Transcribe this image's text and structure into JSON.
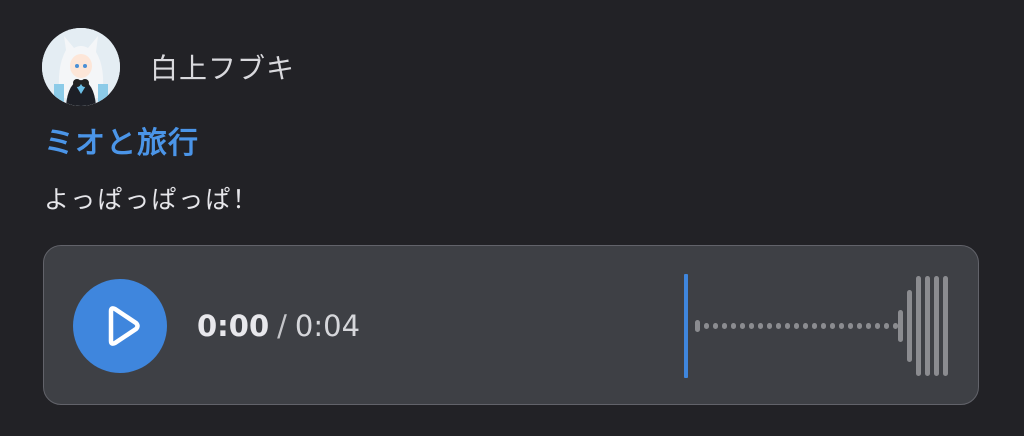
{
  "author": {
    "name": "白上フブキ"
  },
  "post": {
    "title": "ミオと旅行",
    "body": "よっぱっぱっぱ！"
  },
  "player": {
    "current_time": "0:00",
    "separator": "/",
    "duration": "0:04",
    "progress": 0,
    "accent_color": "#3f86dd",
    "play_icon": "play-icon"
  },
  "colors": {
    "background": "#222226",
    "title": "#4b95e8",
    "player_bg": "#3e4045"
  }
}
